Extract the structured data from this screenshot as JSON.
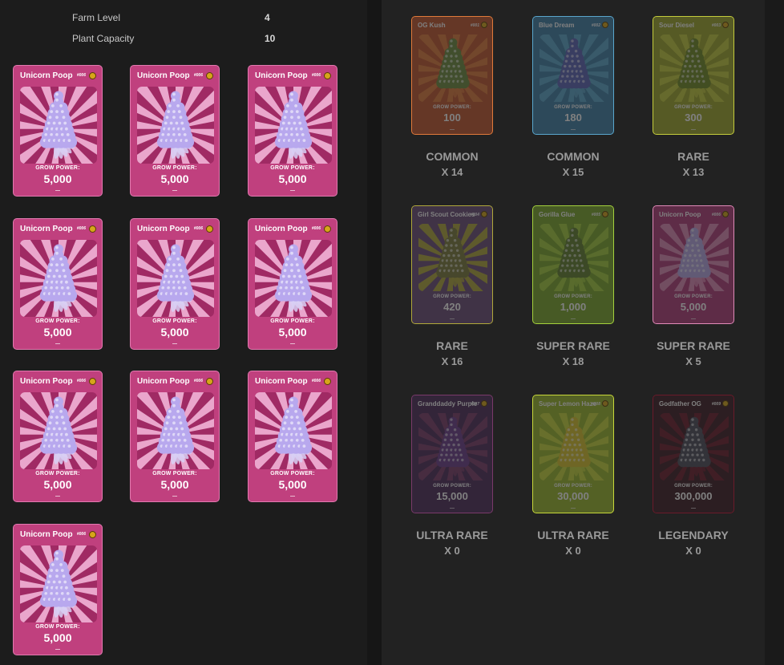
{
  "farm": {
    "level_label": "Farm Level",
    "level_value": "4",
    "capacity_label": "Plant Capacity",
    "capacity_value": "10"
  },
  "planted": [
    {
      "name": "Unicorn Poop",
      "number": "#006",
      "grow_label": "GROW POWER:",
      "grow_value": "5,000"
    },
    {
      "name": "Unicorn Poop",
      "number": "#006",
      "grow_label": "GROW POWER:",
      "grow_value": "5,000"
    },
    {
      "name": "Unicorn Poop",
      "number": "#006",
      "grow_label": "GROW POWER:",
      "grow_value": "5,000"
    },
    {
      "name": "Unicorn Poop",
      "number": "#006",
      "grow_label": "GROW POWER:",
      "grow_value": "5,000"
    },
    {
      "name": "Unicorn Poop",
      "number": "#006",
      "grow_label": "GROW POWER:",
      "grow_value": "5,000"
    },
    {
      "name": "Unicorn Poop",
      "number": "#006",
      "grow_label": "GROW POWER:",
      "grow_value": "5,000"
    },
    {
      "name": "Unicorn Poop",
      "number": "#006",
      "grow_label": "GROW POWER:",
      "grow_value": "5,000"
    },
    {
      "name": "Unicorn Poop",
      "number": "#006",
      "grow_label": "GROW POWER:",
      "grow_value": "5,000"
    },
    {
      "name": "Unicorn Poop",
      "number": "#006",
      "grow_label": "GROW POWER:",
      "grow_value": "5,000"
    },
    {
      "name": "Unicorn Poop",
      "number": "#006",
      "grow_label": "GROW POWER:",
      "grow_value": "5,000"
    }
  ],
  "inventory": [
    {
      "name": "OG Kush",
      "number": "#001",
      "grow_label": "GROW POWER:",
      "grow_value": "100",
      "rarity": "COMMON",
      "count": "X 14",
      "bg": "#c0532c",
      "ray": "#e07a3a",
      "bud": "#6d8a3c"
    },
    {
      "name": "Blue Dream",
      "number": "#002",
      "grow_label": "GROW POWER:",
      "grow_value": "180",
      "rarity": "COMMON",
      "count": "X 15",
      "bg": "#3d7fa8",
      "ray": "#5aa6cc",
      "bud": "#5a63b8"
    },
    {
      "name": "Sour Diesel",
      "number": "#003",
      "grow_label": "GROW POWER:",
      "grow_value": "300",
      "rarity": "RARE",
      "count": "X 13",
      "bg": "#9da62a",
      "ray": "#c4cc3c",
      "bud": "#6f8a22"
    },
    {
      "name": "Girl Scout Cookies",
      "number": "#004",
      "grow_label": "GROW POWER:",
      "grow_value": "420",
      "rarity": "RARE",
      "count": "X 16",
      "bg": "#6a4a78",
      "ray": "#b0a83a",
      "bud": "#7a7a3a"
    },
    {
      "name": "Gorilla Glue",
      "number": "#005",
      "grow_label": "GROW POWER:",
      "grow_value": "1,000",
      "rarity": "SUPER RARE",
      "count": "X 18",
      "bg": "#7aa82a",
      "ray": "#a4d03c",
      "bud": "#5f7f2c"
    },
    {
      "name": "Unicorn Poop",
      "number": "#006",
      "grow_label": "GROW POWER:",
      "grow_value": "5,000",
      "rarity": "SUPER RARE",
      "count": "X 5",
      "bg": "#b03a7a",
      "ray": "#e08ab8",
      "bud": "#b8a8e8"
    },
    {
      "name": "Granddaddy Purple",
      "number": "#007",
      "grow_label": "GROW POWER:",
      "grow_value": "15,000",
      "rarity": "ULTRA RARE",
      "count": "X 0",
      "bg": "#4a2a5a",
      "ray": "#7a3a6a",
      "bud": "#6a3a8a"
    },
    {
      "name": "Super Lemon Haze",
      "number": "#008",
      "grow_label": "GROW POWER:",
      "grow_value": "30,000",
      "rarity": "ULTRA RARE",
      "count": "X 0",
      "bg": "#9ab82a",
      "ray": "#c8d83a",
      "bud": "#d8c42a"
    },
    {
      "name": "Godfather OG",
      "number": "#009",
      "grow_label": "GROW POWER:",
      "grow_value": "300,000",
      "rarity": "LEGENDARY",
      "count": "X 0",
      "bg": "#3a1a22",
      "ray": "#6a1a2a",
      "bud": "#4a4a5a"
    }
  ],
  "colors": {
    "unicorn_bg": "#c0407e",
    "unicorn_ray_light": "#eaa6cc",
    "unicorn_ray_dark": "#a02a64",
    "unicorn_bud": "#b8a8ee",
    "rarity_text": "#9a9a9a"
  }
}
